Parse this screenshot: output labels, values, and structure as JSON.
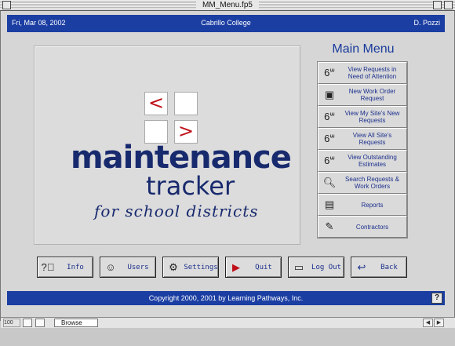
{
  "window": {
    "title": "MM_Menu.fp5"
  },
  "header": {
    "date": "Fri, Mar 08, 2002",
    "school": "Cabrillo College",
    "user": "D. Pozzi"
  },
  "logo": {
    "left_glyph": "<",
    "right_glyph": ">",
    "word1": "maintenance",
    "word2": "tracker",
    "word3": "for school districts"
  },
  "menu": {
    "title": "Main Menu",
    "items": [
      {
        "label": "View Requests in Need of Attention",
        "icon": "glasses-icon"
      },
      {
        "label": "New Work Order Request",
        "icon": "new-request-icon"
      },
      {
        "label": "View My Site's New Requests",
        "icon": "glasses-icon"
      },
      {
        "label": "View All Site's Requests",
        "icon": "glasses-icon"
      },
      {
        "label": "View Outstanding Estimates",
        "icon": "glasses-icon"
      },
      {
        "label": "Search Requests & Work Orders",
        "icon": "magnifier-icon"
      },
      {
        "label": "Reports",
        "icon": "reports-icon"
      },
      {
        "label": "Contractors",
        "icon": "contractors-icon"
      }
    ]
  },
  "toolbar": {
    "info": "Info",
    "users": "Users",
    "settings": "Settings",
    "quit": "Quit",
    "logout": "Log Out",
    "back": "Back"
  },
  "footer": {
    "copyright": "Copyright 2000, 2001 by Learning Pathways, Inc.",
    "help": "?"
  },
  "status": {
    "zoom": "100",
    "mode": "Browse"
  }
}
